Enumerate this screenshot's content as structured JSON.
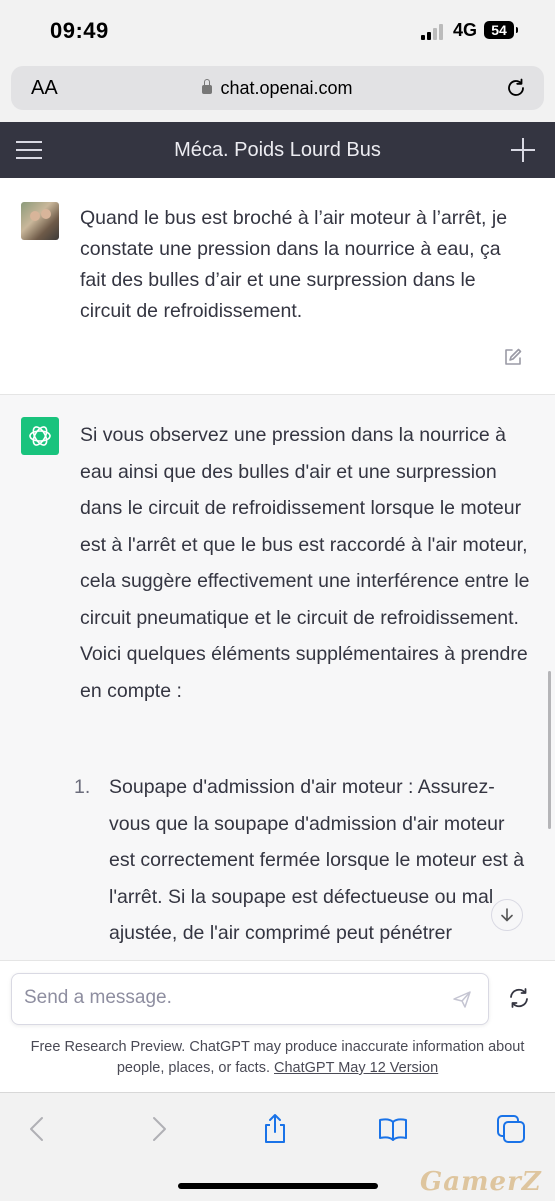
{
  "status_bar": {
    "time": "09:49",
    "network": "4G",
    "battery": "54"
  },
  "browser": {
    "text_size_label": "AA",
    "url": "chat.openai.com"
  },
  "chat_header": {
    "title": "Méca. Poids Lourd Bus"
  },
  "user_message": {
    "text": "Quand le bus est broché à l’air moteur à l’arrêt, je constate une pression dans la nourrice à eau, ça fait des bulles d’air et une surpression dans le circuit de refroidissement."
  },
  "assistant_message": {
    "paragraph": "Si vous observez une pression dans la nourrice à eau ainsi que des bulles d'air et une surpression dans le circuit de refroidissement lorsque le moteur est à l'arrêt et que le bus est raccordé à l'air moteur, cela suggère effectivement une interférence entre le circuit pneumatique et le circuit de refroidissement. Voici quelques éléments supplémentaires à prendre en compte :",
    "list": [
      {
        "number": "1.",
        "text": "Soupape d'admission d'air moteur : Assurez-vous que la soupape d'admission d'air moteur est correctement fermée lorsque le moteur est à l'arrêt. Si la soupape est défectueuse ou mal ajustée, de l'air comprimé peut pénétrer"
      }
    ]
  },
  "composer": {
    "placeholder": "Send a message."
  },
  "disclaimer": {
    "text": "Free Research Preview. ChatGPT may produce inaccurate information about people, places, or facts.",
    "link": "ChatGPT May 12 Version"
  },
  "watermark": "GamerZ",
  "colors": {
    "header_bg": "#343541",
    "gpt_green": "#19c37d",
    "assistant_bg": "#f7f7f8",
    "ios_blue": "#1a73e8"
  }
}
